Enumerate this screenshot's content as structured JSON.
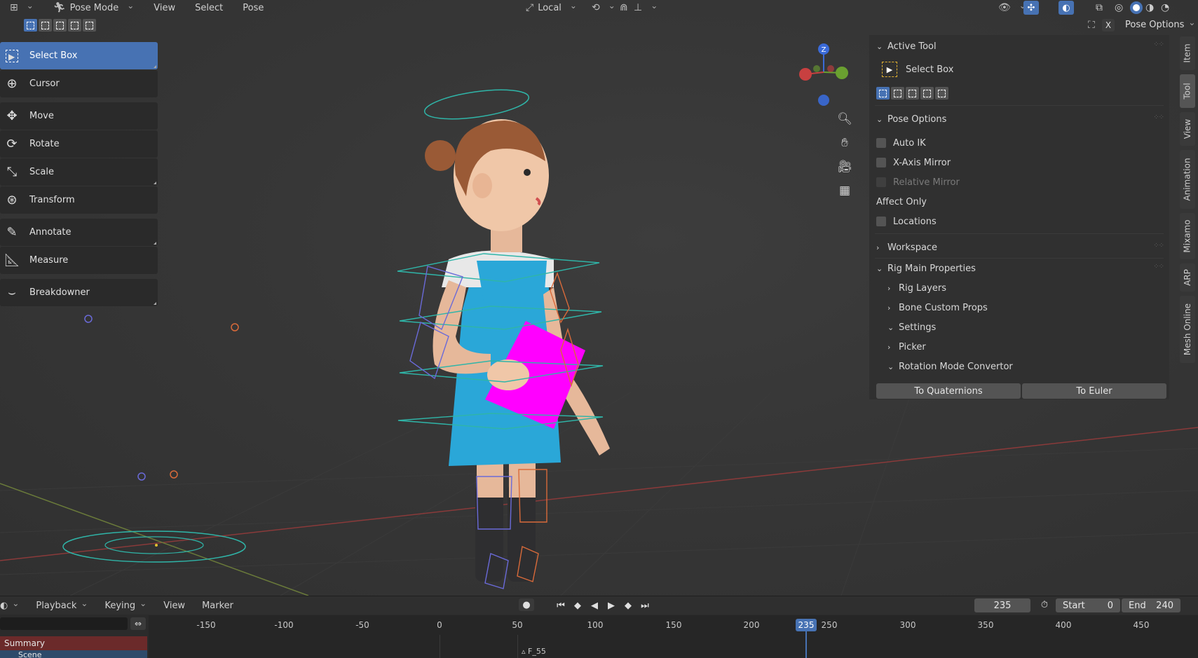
{
  "header": {
    "mode": "Pose Mode",
    "menus": [
      "View",
      "Select",
      "Pose"
    ],
    "transform_orientation": "Local",
    "pose_options": "Pose Options",
    "close_label": "X"
  },
  "toolbar": {
    "tools": [
      {
        "label": "Select Box",
        "icon": "select-box-icon",
        "active": true
      },
      {
        "label": "Cursor",
        "icon": "cursor-icon"
      },
      {
        "label": "Move",
        "icon": "move-icon"
      },
      {
        "label": "Rotate",
        "icon": "rotate-icon"
      },
      {
        "label": "Scale",
        "icon": "scale-icon"
      },
      {
        "label": "Transform",
        "icon": "transform-icon"
      },
      {
        "label": "Annotate",
        "icon": "annotate-icon"
      },
      {
        "label": "Measure",
        "icon": "measure-icon"
      },
      {
        "label": "Breakdowner",
        "icon": "breakdowner-icon"
      }
    ]
  },
  "gizmo": {
    "z_label": "Z"
  },
  "sidebar": {
    "active_tool": {
      "title": "Active Tool",
      "tool_name": "Select Box"
    },
    "pose_options": {
      "title": "Pose Options",
      "auto_ik": "Auto IK",
      "x_axis_mirror": "X-Axis Mirror",
      "relative_mirror": "Relative Mirror",
      "affect_only": "Affect Only",
      "locations": "Locations"
    },
    "workspace": "Workspace",
    "rig_main": {
      "title": "Rig Main Properties",
      "rig_layers": "Rig Layers",
      "bone_custom_props": "Bone Custom Props",
      "settings": "Settings",
      "picker": "Picker",
      "rotation_mode": "Rotation Mode Convertor",
      "to_quaternions": "To Quaternions",
      "to_euler": "To Euler"
    },
    "tabs": [
      "Item",
      "Tool",
      "View",
      "Animation",
      "Mixamo",
      "ARP",
      "Mesh Online"
    ]
  },
  "timeline": {
    "menus": [
      "Playback",
      "Keying",
      "View",
      "Marker"
    ],
    "current_frame": "235",
    "start_label": "Start",
    "start_value": "0",
    "end_label": "End",
    "end_value": "240",
    "ticks": [
      "-150",
      "-100",
      "-50",
      "0",
      "50",
      "100",
      "150",
      "200",
      "250",
      "300",
      "350",
      "400",
      "450"
    ],
    "marker_label": "F_55",
    "summary": "Summary",
    "scene": "Scene"
  }
}
